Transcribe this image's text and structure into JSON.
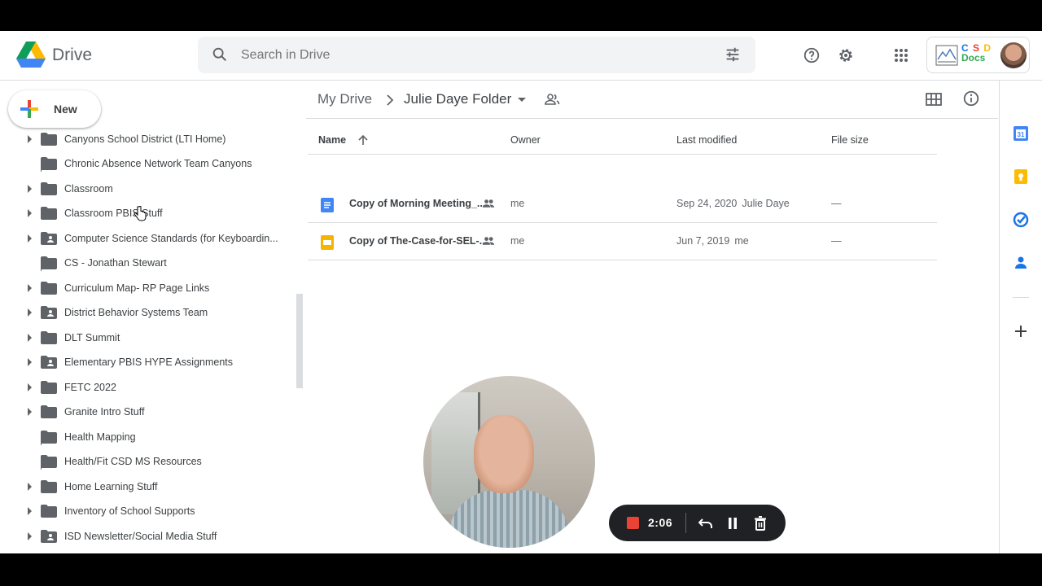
{
  "header": {
    "app_name": "Drive",
    "search_placeholder": "Search in Drive",
    "account_brand": [
      "C",
      "S",
      "D"
    ],
    "account_brand_sub": "Docs"
  },
  "sidebar": {
    "new_label": "New",
    "items": [
      {
        "label": "Canyons School District (LTI Home)",
        "expandable": true,
        "shared": false
      },
      {
        "label": "Chronic Absence Network Team Canyons",
        "expandable": false,
        "shortcut": true
      },
      {
        "label": "Classroom",
        "expandable": true,
        "shared": false
      },
      {
        "label": "Classroom PBIS Stuff",
        "expandable": true,
        "shared": false
      },
      {
        "label": "Computer Science Standards (for Keyboardin...",
        "expandable": true,
        "shared": true
      },
      {
        "label": "CS - Jonathan Stewart",
        "expandable": false,
        "shortcut": true
      },
      {
        "label": "Curriculum Map- RP Page Links",
        "expandable": true,
        "shared": false
      },
      {
        "label": "District Behavior Systems Team",
        "expandable": true,
        "shared": true
      },
      {
        "label": "DLT Summit",
        "expandable": true,
        "shared": false
      },
      {
        "label": "Elementary PBIS HYPE Assignments",
        "expandable": true,
        "shared": true
      },
      {
        "label": "FETC 2022",
        "expandable": true,
        "shared": false
      },
      {
        "label": "Granite Intro Stuff",
        "expandable": true,
        "shared": false
      },
      {
        "label": "Health Mapping",
        "expandable": false,
        "shortcut": true
      },
      {
        "label": "Health/Fit CSD MS Resources",
        "expandable": false,
        "shortcut": true
      },
      {
        "label": "Home Learning Stuff",
        "expandable": true,
        "shared": false
      },
      {
        "label": "Inventory of School Supports",
        "expandable": true,
        "shared": false
      },
      {
        "label": "ISD Newsletter/Social Media Stuff",
        "expandable": true,
        "shared": true
      }
    ]
  },
  "breadcrumb": {
    "root": "My Drive",
    "current": "Julie Daye Folder"
  },
  "table": {
    "headers": {
      "name": "Name",
      "owner": "Owner",
      "modified": "Last modified",
      "size": "File size"
    },
    "rows": [
      {
        "name": "Copy of Morning Meeting_...",
        "type": "doc",
        "owner": "me",
        "modified": "Sep 24, 2020",
        "modified_by": "Julie Daye",
        "size": "—"
      },
      {
        "name": "Copy of The-Case-for-SEL-...",
        "type": "slides",
        "owner": "me",
        "modified": "Jun 7, 2019",
        "modified_by": "me",
        "size": "—"
      }
    ]
  },
  "recorder": {
    "time": "2:06"
  },
  "colors": {
    "doc_blue": "#4285f4",
    "slides_yellow": "#f4b400",
    "rec_red": "#ea4335"
  }
}
